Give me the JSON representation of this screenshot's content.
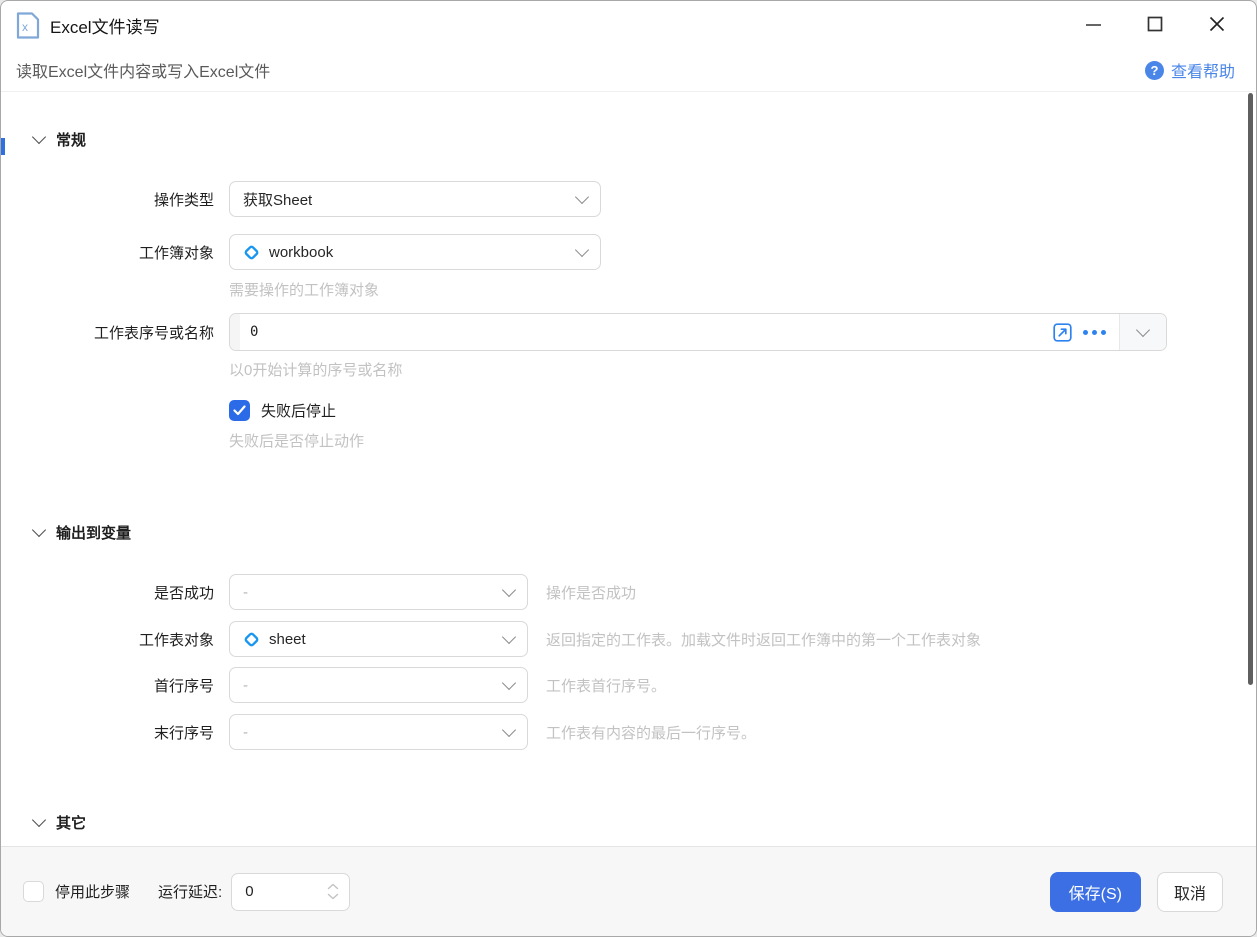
{
  "window": {
    "title": "Excel文件读写",
    "subtitle": "读取Excel文件内容或写入Excel文件",
    "help_link": "查看帮助",
    "icons": {
      "window": "excel-document-icon",
      "help": "question-circle-icon",
      "minimize": "minimize-icon",
      "maximize": "maximize-icon",
      "close": "close-icon"
    }
  },
  "sections": [
    {
      "title": "常规"
    },
    {
      "title": "输出到变量"
    },
    {
      "title": "其它"
    }
  ],
  "general": {
    "operation_type": {
      "label": "操作类型",
      "value": "获取Sheet"
    },
    "workbook_object": {
      "label": "工作簿对象",
      "value": "workbook",
      "icon": "variable-diamond-icon",
      "helper": "需要操作的工作簿对象"
    },
    "sheet_index": {
      "label": "工作表序号或名称",
      "value": "0",
      "helper": "以0开始计算的序号或名称",
      "icons": [
        "open-in-editor-icon",
        "ellipsis-icon",
        "chevron-down-icon"
      ]
    },
    "stop_on_failure": {
      "label": "失败后停止",
      "checked": true,
      "helper": "失败后是否停止动作"
    }
  },
  "output": {
    "success": {
      "label": "是否成功",
      "value": "-",
      "helper": "操作是否成功"
    },
    "sheet_object": {
      "label": "工作表对象",
      "value": "sheet",
      "icon": "variable-diamond-icon",
      "helper": "返回指定的工作表。加载文件时返回工作簿中的第一个工作表对象"
    },
    "first_row": {
      "label": "首行序号",
      "value": "-",
      "helper": "工作表首行序号。"
    },
    "last_row": {
      "label": "末行序号",
      "value": "-",
      "helper": "工作表有内容的最后一行序号。"
    }
  },
  "footer": {
    "disable_step_label": "停用此步骤",
    "disable_step_checked": false,
    "run_delay_label": "运行延迟:",
    "run_delay_value": "0",
    "save_label": "保存(S)",
    "cancel_label": "取消"
  },
  "colors": {
    "accent_blue": "#3b6fe3",
    "checkbox_blue": "#2b6be8",
    "icon_blue": "#2e82f0",
    "diamond_blue": "#1896f0",
    "link_blue": "#4a86e8",
    "helper_gray": "#c2c2c2",
    "footer_bg": "#f7f7f7"
  }
}
